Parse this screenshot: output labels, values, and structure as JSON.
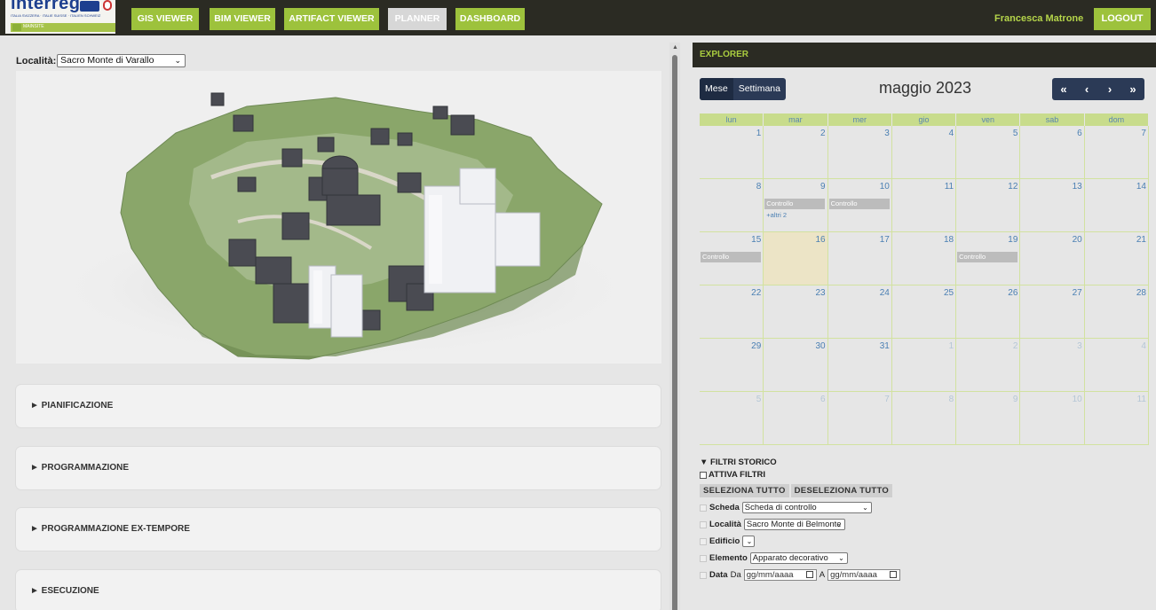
{
  "header": {
    "logo": {
      "wordmark": "interreg",
      "program": "ITALIA SVIZZERA · ITALIE SUISSE · ITALIEN SCHWEIZ",
      "project": "MAINSITE"
    },
    "nav": [
      {
        "label": "GIS VIEWER"
      },
      {
        "label": "BIM VIEWER"
      },
      {
        "label": "ARTIFACT VIEWER"
      },
      {
        "label": "PLANNER",
        "active": true
      },
      {
        "label": "DASHBOARD"
      }
    ],
    "user": "Francesca Matrone",
    "logout": "LOGOUT",
    "accent_color": "#9dc23c",
    "dark_color": "#2b2b23"
  },
  "left": {
    "location_label": "Località:",
    "location_value": "Sacro Monte di Varallo",
    "sections": [
      {
        "label": "► PIANIFICAZIONE"
      },
      {
        "label": "► PROGRAMMAZIONE"
      },
      {
        "label": "► PROGRAMMAZIONE EX-TEMPORE"
      },
      {
        "label": "► ESECUZIONE"
      }
    ]
  },
  "explorer": {
    "title": "EXPLORER",
    "view_month": "Mese",
    "view_week": "Settimana",
    "month_title": "maggio 2023",
    "nav": {
      "first": "«",
      "prev": "‹",
      "next": "›",
      "last": "»"
    },
    "weekdays": [
      "lun",
      "mar",
      "mer",
      "gio",
      "ven",
      "sab",
      "dom"
    ],
    "weeks": [
      [
        {
          "d": "1"
        },
        {
          "d": "2"
        },
        {
          "d": "3"
        },
        {
          "d": "4"
        },
        {
          "d": "5"
        },
        {
          "d": "6"
        },
        {
          "d": "7"
        }
      ],
      [
        {
          "d": "8"
        },
        {
          "d": "9",
          "event": "Controllo",
          "more": "+altri 2"
        },
        {
          "d": "10",
          "event": "Controllo"
        },
        {
          "d": "11"
        },
        {
          "d": "12"
        },
        {
          "d": "13"
        },
        {
          "d": "14"
        }
      ],
      [
        {
          "d": "15",
          "event": "Controllo"
        },
        {
          "d": "16",
          "today": true
        },
        {
          "d": "17"
        },
        {
          "d": "18"
        },
        {
          "d": "19",
          "event": "Controllo"
        },
        {
          "d": "20"
        },
        {
          "d": "21"
        }
      ],
      [
        {
          "d": "22"
        },
        {
          "d": "23"
        },
        {
          "d": "24"
        },
        {
          "d": "25"
        },
        {
          "d": "26"
        },
        {
          "d": "27"
        },
        {
          "d": "28"
        }
      ],
      [
        {
          "d": "29"
        },
        {
          "d": "30"
        },
        {
          "d": "31"
        },
        {
          "d": "1",
          "other": true
        },
        {
          "d": "2",
          "other": true
        },
        {
          "d": "3",
          "other": true
        },
        {
          "d": "4",
          "other": true
        }
      ],
      [
        {
          "d": "5",
          "other": true
        },
        {
          "d": "6",
          "other": true
        },
        {
          "d": "7",
          "other": true
        },
        {
          "d": "8",
          "other": true
        },
        {
          "d": "9",
          "other": true
        },
        {
          "d": "10",
          "other": true
        },
        {
          "d": "11",
          "other": true
        }
      ]
    ],
    "filters": {
      "title": "▼ FILTRI STORICO",
      "activate": "ATTIVA FILTRI",
      "select_all": "SELEZIONA TUTTO",
      "deselect_all": "DESELEZIONA TUTTO",
      "scheda_label": "Scheda",
      "scheda_value": "Scheda di controllo",
      "localita_label": "Località",
      "localita_value": "Sacro Monte di Belmonte",
      "edificio_label": "Edificio",
      "edificio_value": "",
      "elemento_label": "Elemento",
      "elemento_value": "Apparato decorativo",
      "data_label": "Data",
      "da_label": "Da",
      "a_label": "A",
      "date_placeholder": "gg/mm/aaaa"
    }
  }
}
